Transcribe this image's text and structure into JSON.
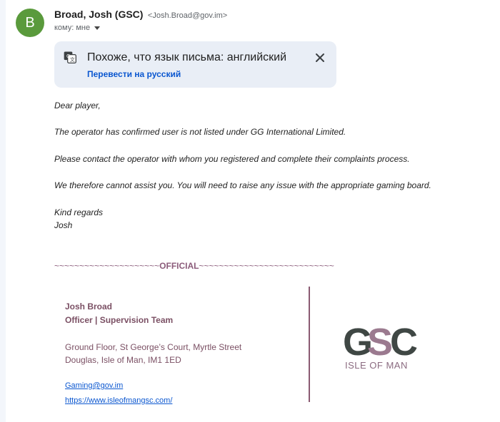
{
  "sender": {
    "avatar_letter": "B",
    "name": "Broad, Josh (GSC)",
    "email": "<Josh.Broad@gov.im>",
    "recipient": "кому: мне"
  },
  "translate": {
    "message": "Похоже, что язык письма: английский",
    "action": "Перевести на русский"
  },
  "body": {
    "lines": [
      "Dear player,",
      "The operator has confirmed user is not listed under GG International Limited.",
      "Please contact the operator with whom you registered and complete their complaints process.",
      "We therefore cannot assist you.  You will need to raise any issue with the appropriate gaming board.",
      "Kind regards",
      "Josh"
    ]
  },
  "official": {
    "prefix": "~~~~~~~~~~~~~~~~~~~~~",
    "word": "OFFICIAL",
    "suffix": "~~~~~~~~~~~~~~~~~~~~~~~~~~~"
  },
  "signature": {
    "name": "Josh Broad",
    "title": "Officer | Supervision Team",
    "address1": "Ground  Floor, St George’s Court, Myrtle Street",
    "address2": "Douglas, Isle of Man, IM1 1ED",
    "email": "Gaming@gov.im",
    "website": "https://www.isleofmangsc.com/"
  },
  "logo": {
    "letters": "GSC",
    "subtitle": "ISLE OF MAN"
  },
  "colors": {
    "avatar": "#5a9a3c",
    "translate_bg": "#e9eef6",
    "link": "#0b57d0",
    "signature": "#7b5064",
    "logo_dark": "#3f4744",
    "logo_accent": "#9b7a8f"
  }
}
